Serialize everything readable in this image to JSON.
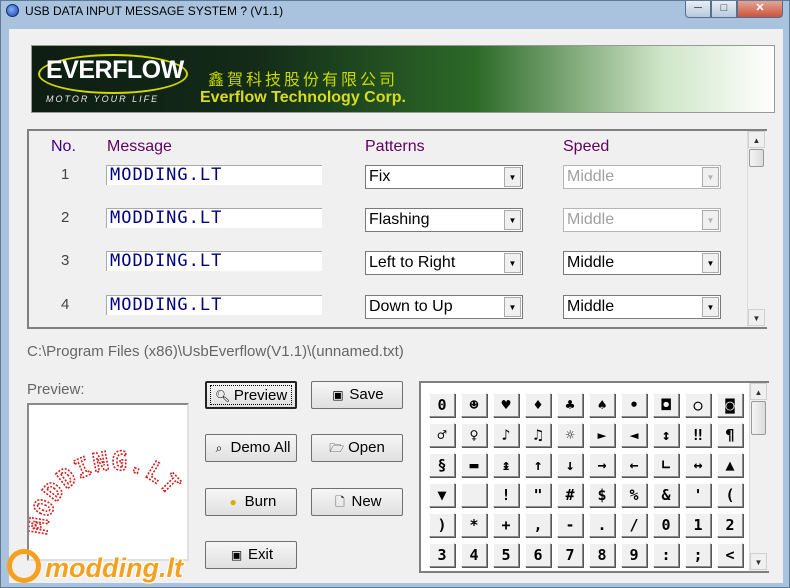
{
  "window": {
    "title": "USB DATA INPUT MESSAGE SYSTEM ? (V1.1)",
    "min": "─",
    "max": "□",
    "close": "✕"
  },
  "banner": {
    "logo": "EVERFLOW",
    "slogan": "MOTOR YOUR LIFE",
    "chinese_name": "鑫賀科技股份有限公司",
    "english_name": "Everflow Technology Corp."
  },
  "table": {
    "headers": {
      "no": "No.",
      "message": "Message",
      "patterns": "Patterns",
      "speed": "Speed"
    },
    "rows": [
      {
        "no": "1",
        "message": "MODDING.LT",
        "pattern": "Fix",
        "speed": "Middle",
        "speed_enabled": false
      },
      {
        "no": "2",
        "message": "MODDING.LT",
        "pattern": "Flashing",
        "speed": "Middle",
        "speed_enabled": false
      },
      {
        "no": "3",
        "message": "MODDING.LT",
        "pattern": "Left to Right",
        "speed": "Middle",
        "speed_enabled": true
      },
      {
        "no": "4",
        "message": "MODDING.LT",
        "pattern": "Down to Up",
        "speed": "Middle",
        "speed_enabled": true
      }
    ]
  },
  "file_path": "C:\\Program Files (x86)\\UsbEverflow(V1.1)\\(unnamed.txt)",
  "preview": {
    "label": "Preview:",
    "text": "MODDING.LT",
    "color": "#d02020"
  },
  "buttons": {
    "preview": "Preview",
    "save": "Save",
    "demo_all": "Demo All",
    "open": "Open",
    "burn": "Burn",
    "new": "New",
    "exit": "Exit"
  },
  "glyphs": [
    [
      "0",
      "☻",
      "♥",
      "♦",
      "♣",
      "♠",
      "•",
      "◘",
      "○",
      "◙"
    ],
    [
      "♂",
      "♀",
      "♪",
      "♫",
      "☼",
      "►",
      "◄",
      "↕",
      "‼",
      "¶"
    ],
    [
      "§",
      "▬",
      "↨",
      "↑",
      "↓",
      "→",
      "←",
      "∟",
      "↔",
      "▲"
    ],
    [
      "▼",
      " ",
      "!",
      "\"",
      "#",
      "$",
      "%",
      "&",
      "'",
      "("
    ],
    [
      ")",
      "*",
      "+",
      ",",
      "-",
      ".",
      "/",
      "0",
      "1",
      "2"
    ],
    [
      "3",
      "4",
      "5",
      "6",
      "7",
      "8",
      "9",
      ":",
      ";",
      "<"
    ]
  ],
  "watermark": "modding.lt",
  "icons": {
    "preview": "magnifier-icon",
    "save": "floppy-icon",
    "demo_all": "magnifier-icon",
    "open": "folder-icon",
    "burn": "bulb-icon",
    "new": "page-icon",
    "exit": "stop-icon"
  }
}
